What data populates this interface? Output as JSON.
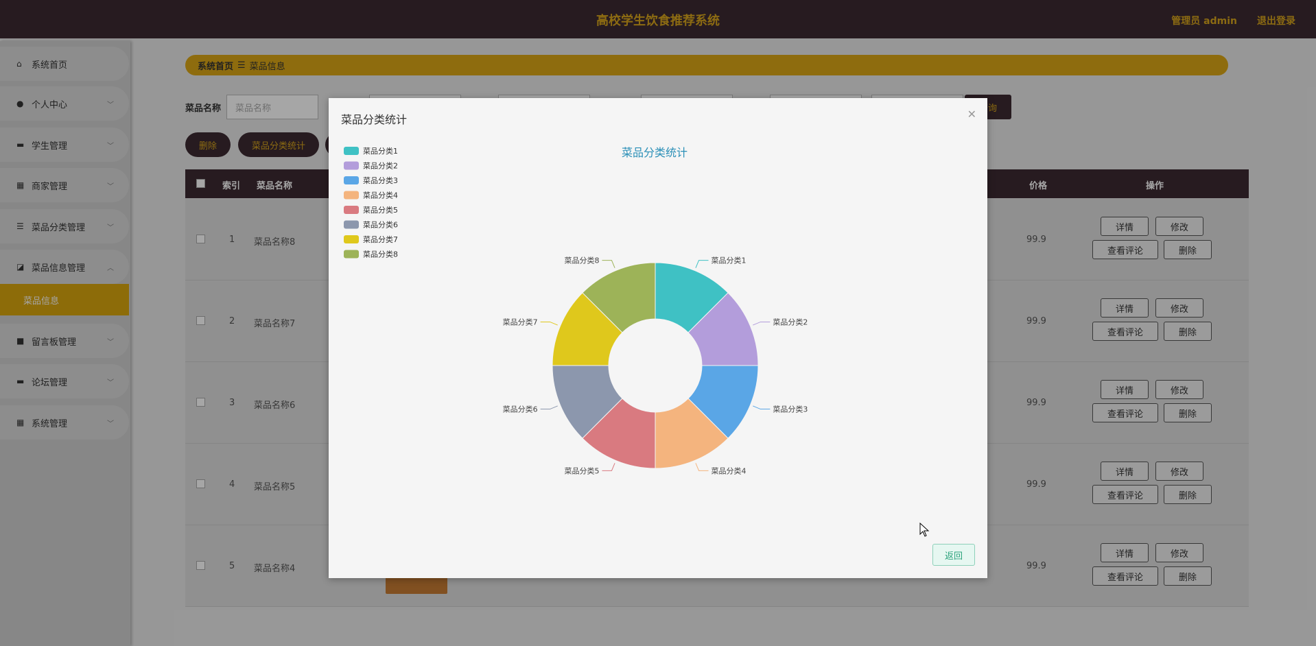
{
  "header": {
    "title": "高校学生饮食推荐系统",
    "admin": "管理员 admin",
    "logout": "退出登录"
  },
  "sidebar": {
    "items": [
      {
        "label": "系统首页",
        "icon": "home-icon"
      },
      {
        "label": "个人中心",
        "icon": "user-icon"
      },
      {
        "label": "学生管理",
        "icon": "monitor-icon"
      },
      {
        "label": "商家管理",
        "icon": "grid-icon"
      },
      {
        "label": "菜品分类管理",
        "icon": "list-icon"
      },
      {
        "label": "菜品信息管理",
        "icon": "chart-icon"
      },
      {
        "label": "留言板管理",
        "icon": "video-icon"
      },
      {
        "label": "论坛管理",
        "icon": "monitor-icon"
      },
      {
        "label": "系统管理",
        "icon": "grid-icon"
      }
    ],
    "active_sub": "菜品信息"
  },
  "breadcrumb": {
    "home": "系统首页",
    "current": "菜品信息"
  },
  "search": {
    "label": "菜品名称",
    "placeholder": "菜品名称",
    "query_button": "查询"
  },
  "actions": {
    "delete": "删除",
    "stats": "菜品分类统计"
  },
  "table": {
    "headers": [
      "索引",
      "菜品名称",
      "价格",
      "操作"
    ],
    "rows": [
      {
        "index": "1",
        "name": "菜品名称8",
        "price": "99.9"
      },
      {
        "index": "2",
        "name": "菜品名称7",
        "price": "99.9"
      },
      {
        "index": "3",
        "name": "菜品名称6",
        "price": "99.9"
      },
      {
        "index": "4",
        "name": "菜品名称5",
        "price": "99.9"
      },
      {
        "index": "5",
        "name": "菜品名称4",
        "price": "99.9"
      }
    ],
    "row_buttons": {
      "detail": "详情",
      "edit": "修改",
      "comments": "查看评论",
      "delete": "删除"
    }
  },
  "modal": {
    "title": "菜品分类统计",
    "back_button": "返回"
  },
  "chart_data": {
    "type": "pie",
    "title": "菜品分类统计",
    "legend_position": "top-left",
    "categories": [
      "菜品分类1",
      "菜品分类2",
      "菜品分类3",
      "菜品分类4",
      "菜品分类5",
      "菜品分类6",
      "菜品分类7",
      "菜品分类8"
    ],
    "values": [
      1,
      1,
      1,
      1,
      1,
      1,
      1,
      1
    ],
    "colors": [
      "#3fc1c4",
      "#b39ddb",
      "#5aa6e6",
      "#f4b47e",
      "#d97a80",
      "#8c97ad",
      "#dfc81c",
      "#9db358"
    ]
  }
}
